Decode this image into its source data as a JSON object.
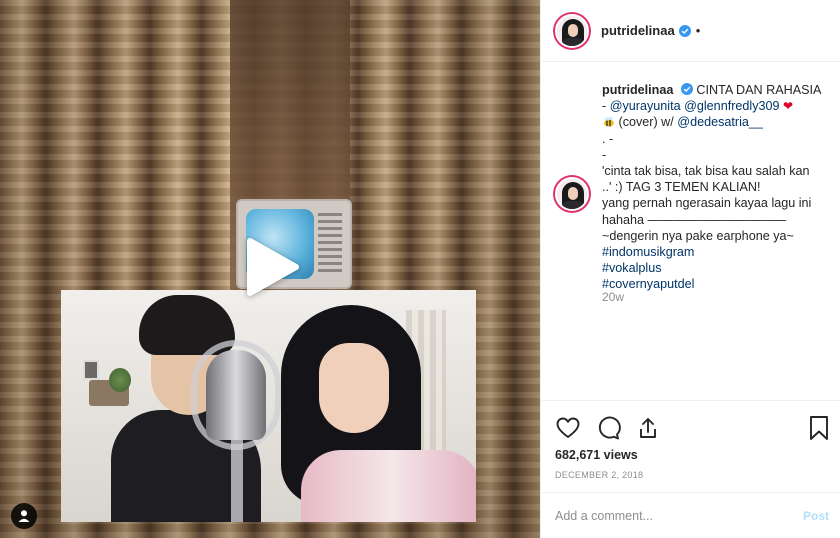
{
  "header": {
    "username": "putridelinaa",
    "separator": "•"
  },
  "caption": {
    "username": "putridelinaa",
    "title": "CINTA DAN RAHASIA",
    "line2_prefix": "- ",
    "mention1": "@yurayunita",
    "mention2": "@glennfredly309",
    "heart": "❤",
    "cover_text": " (cover) w/ ",
    "mention3": "@dedesatria__",
    "line4": ". -",
    "line5": "-",
    "line6": "'cinta tak bisa, tak bisa kau salah kan",
    "line7": "..' :) TAG 3 TEMEN KALIAN!",
    "line8": "yang pernah ngerasain kayaa lagu ini",
    "line9": "hahaha ———————————",
    "line10": "~dengerin nya pake earphone ya~",
    "hashtag1": "#indomusikgram",
    "hashtag2": "#vokalplus",
    "hashtag3": "#covernyaputdel",
    "age": "20w"
  },
  "stats": {
    "views": "682,671 views",
    "date": "DECEMBER 2, 2018"
  },
  "comment": {
    "placeholder": "Add a comment...",
    "post_label": "Post"
  },
  "icons": {
    "play": "play-icon",
    "tag_users": "user-icon",
    "verified": "verified-badge-icon",
    "like": "heart-icon",
    "comment": "comment-icon",
    "share": "share-icon",
    "save": "bookmark-icon"
  },
  "colors": {
    "link": "#003569",
    "verified": "#3897f0",
    "post_button_disabled": "#b2dffc",
    "muted": "#8e8e8e"
  }
}
